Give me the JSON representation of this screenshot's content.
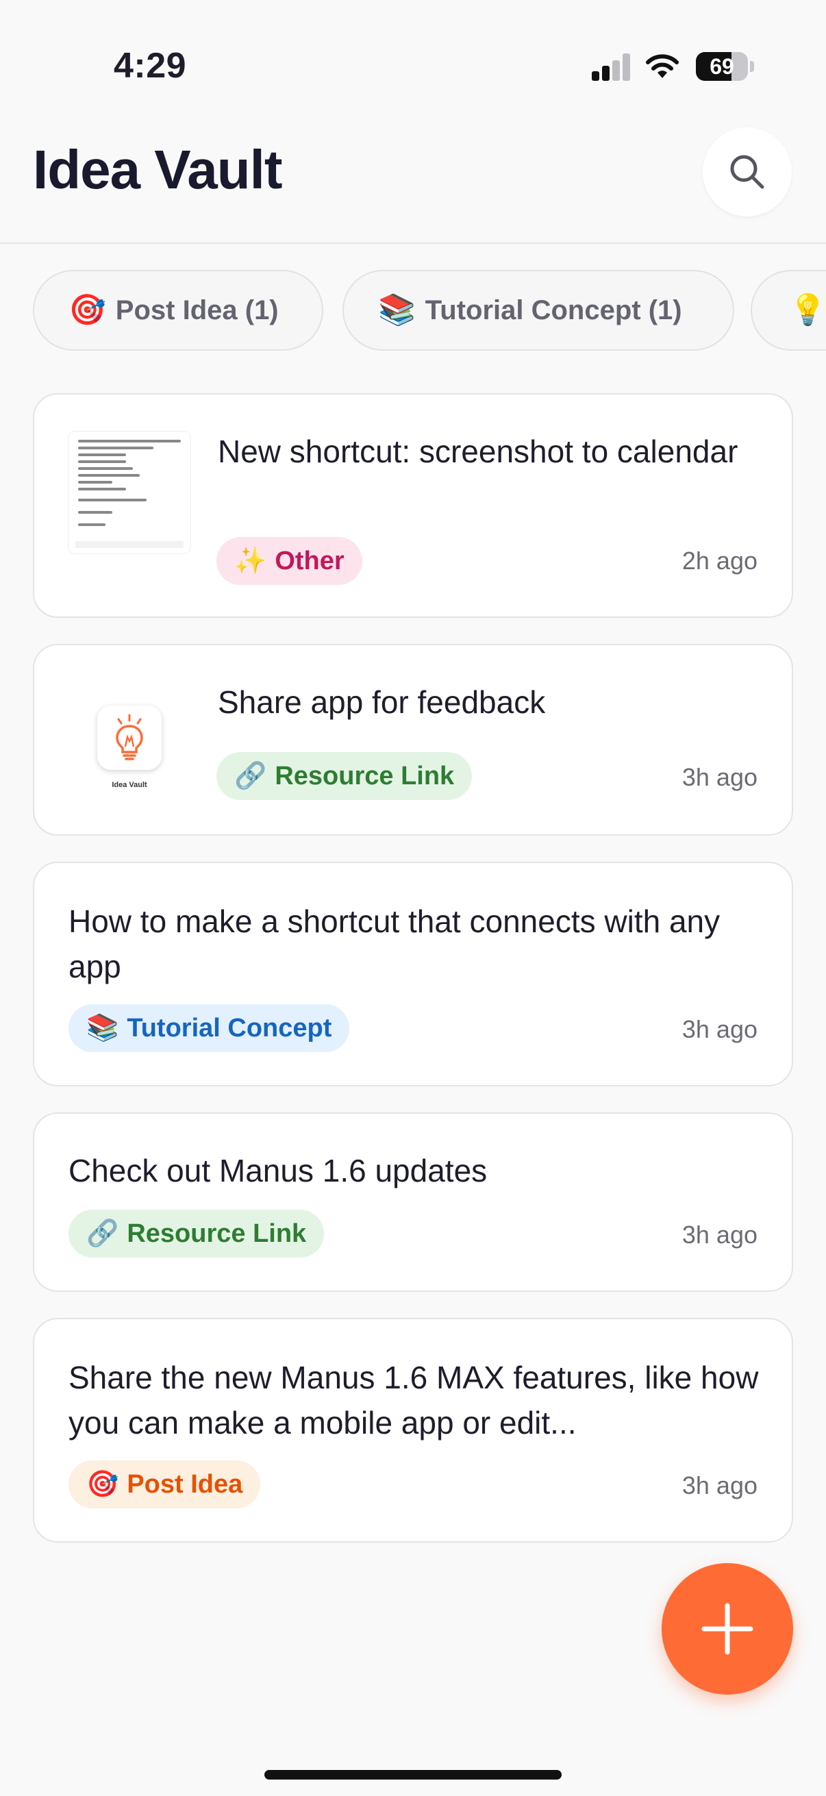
{
  "status_bar": {
    "time": "4:29",
    "battery_level": 69,
    "battery_text": "69"
  },
  "header": {
    "title": "Idea Vault",
    "search_icon": "search-icon"
  },
  "filters": [
    {
      "emoji": "🎯",
      "label": "Post Idea (1)"
    },
    {
      "emoji": "📚",
      "label": "Tutorial Concept (1)"
    },
    {
      "emoji": "💡",
      "label": ""
    }
  ],
  "ideas": [
    {
      "title": "New shortcut: screenshot to calendar",
      "tag_emoji": "✨",
      "tag": "Other",
      "time": "2h ago",
      "thumbnail": "screenshot"
    },
    {
      "title": "Share app for feedback",
      "tag_emoji": "🔗",
      "tag": "Resource Link",
      "time": "3h ago",
      "thumbnail": "app-icon",
      "thumbnail_caption": "Idea Vault"
    },
    {
      "title": "How to make a shortcut that connects with any app",
      "tag_emoji": "📚",
      "tag": "Tutorial Concept",
      "time": "3h ago"
    },
    {
      "title": "Check out Manus 1.6 updates",
      "tag_emoji": "🔗",
      "tag": "Resource Link",
      "time": "3h ago"
    },
    {
      "title": "Share the new Manus 1.6 MAX features, like how you can make a mobile app or edit...",
      "tag_emoji": "🎯",
      "tag": "Post Idea",
      "time": "3h ago"
    }
  ],
  "fab": {
    "icon": "plus-icon"
  },
  "colors": {
    "accent": "#ff6b35",
    "tag_other": "#c2185b",
    "tag_resource": "#2e7d32",
    "tag_tutorial": "#1565c0",
    "tag_post": "#e65100"
  }
}
